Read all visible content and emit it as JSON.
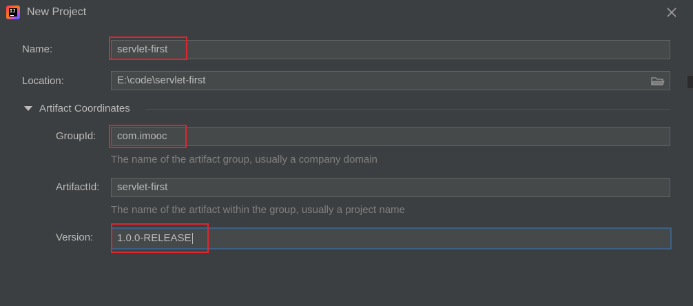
{
  "window": {
    "title": "New Project",
    "close_icon": "close-icon"
  },
  "form": {
    "name": {
      "label": "Name:",
      "value": "servlet-first"
    },
    "location": {
      "label": "Location:",
      "value": "E:\\code\\servlet-first",
      "browse_icon": "folder-icon"
    },
    "artifact_section": {
      "label": "Artifact Coordinates",
      "expanded": true
    },
    "group_id": {
      "label": "GroupId:",
      "value": "com.imooc",
      "hint": "The name of the artifact group, usually a company domain"
    },
    "artifact_id": {
      "label": "ArtifactId:",
      "value": "servlet-first",
      "hint": "The name of the artifact within the group, usually a project name"
    },
    "version": {
      "label": "Version:",
      "value": "1.0.0-RELEASE",
      "focused": true
    }
  },
  "colors": {
    "background": "#3c3f41",
    "field_background": "#45494a",
    "focus_border": "#3d6185",
    "highlight_box": "#e0252e",
    "text": "#bbbbbb",
    "hint_text": "#808080"
  }
}
